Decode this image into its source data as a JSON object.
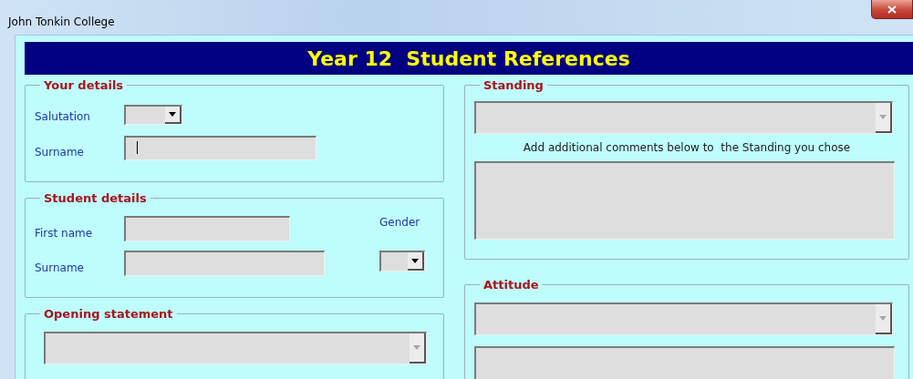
{
  "window": {
    "title": "John Tonkin College"
  },
  "banner": {
    "title": "Year 12  Student References"
  },
  "your_details": {
    "legend": "Your details",
    "salutation": {
      "label": "Salutation",
      "disabled": false
    },
    "surname": {
      "label": "Surname",
      "focused": true
    }
  },
  "student_details": {
    "legend": "Student details",
    "first_name": {
      "label": "First name",
      "focused": false
    },
    "surname": {
      "label": "Surname",
      "focused": false
    },
    "gender": {
      "label": "Gender",
      "disabled": false
    }
  },
  "opening_statement": {
    "legend": "Opening statement",
    "combo": {
      "disabled": true
    }
  },
  "standing": {
    "legend": "Standing",
    "combo": {
      "disabled": true
    },
    "note": "Add additional comments below to  the Standing you chose"
  },
  "attitude": {
    "legend": "Attitude",
    "combo": {
      "disabled": true
    }
  }
}
